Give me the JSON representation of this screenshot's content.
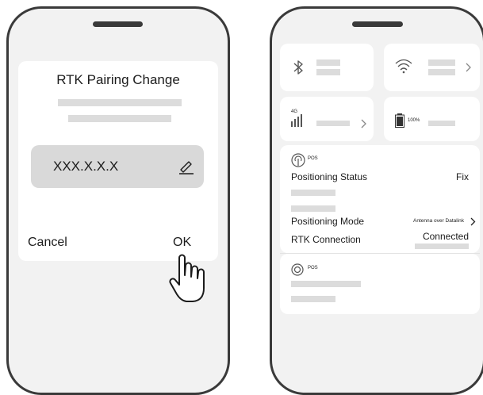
{
  "dialog": {
    "title": "RTK Pairing Change",
    "ip_value": "XXX.X.X.X",
    "cancel_label": "Cancel",
    "ok_label": "OK"
  },
  "status_panel": {
    "battery_percent": "100%",
    "network_label": "4G",
    "pos_card_1": {
      "tag": "POS",
      "positioning_status_label": "Positioning Status",
      "positioning_status_value": "Fix",
      "positioning_mode_label": "Positioning Mode",
      "positioning_mode_value": "Antenna over Datalink",
      "rtk_connection_label": "RTK Connection",
      "rtk_connection_value": "Connected"
    },
    "pos_card_2": {
      "tag": "POS"
    }
  },
  "icons": {
    "pointer": "hand-pointer-icon",
    "edit": "pencil-icon",
    "bluetooth": "bluetooth-icon",
    "wifi": "wifi-icon",
    "signal": "cellular-signal-icon",
    "battery": "battery-icon",
    "pos": "antenna-icon",
    "pos_alt": "target-icon"
  },
  "colors": {
    "frame": "#3a3a3a",
    "screen": "#f2f2f2",
    "card": "#ffffff",
    "placeholder": "#dcdcdc",
    "input": "#d9d9d9"
  }
}
